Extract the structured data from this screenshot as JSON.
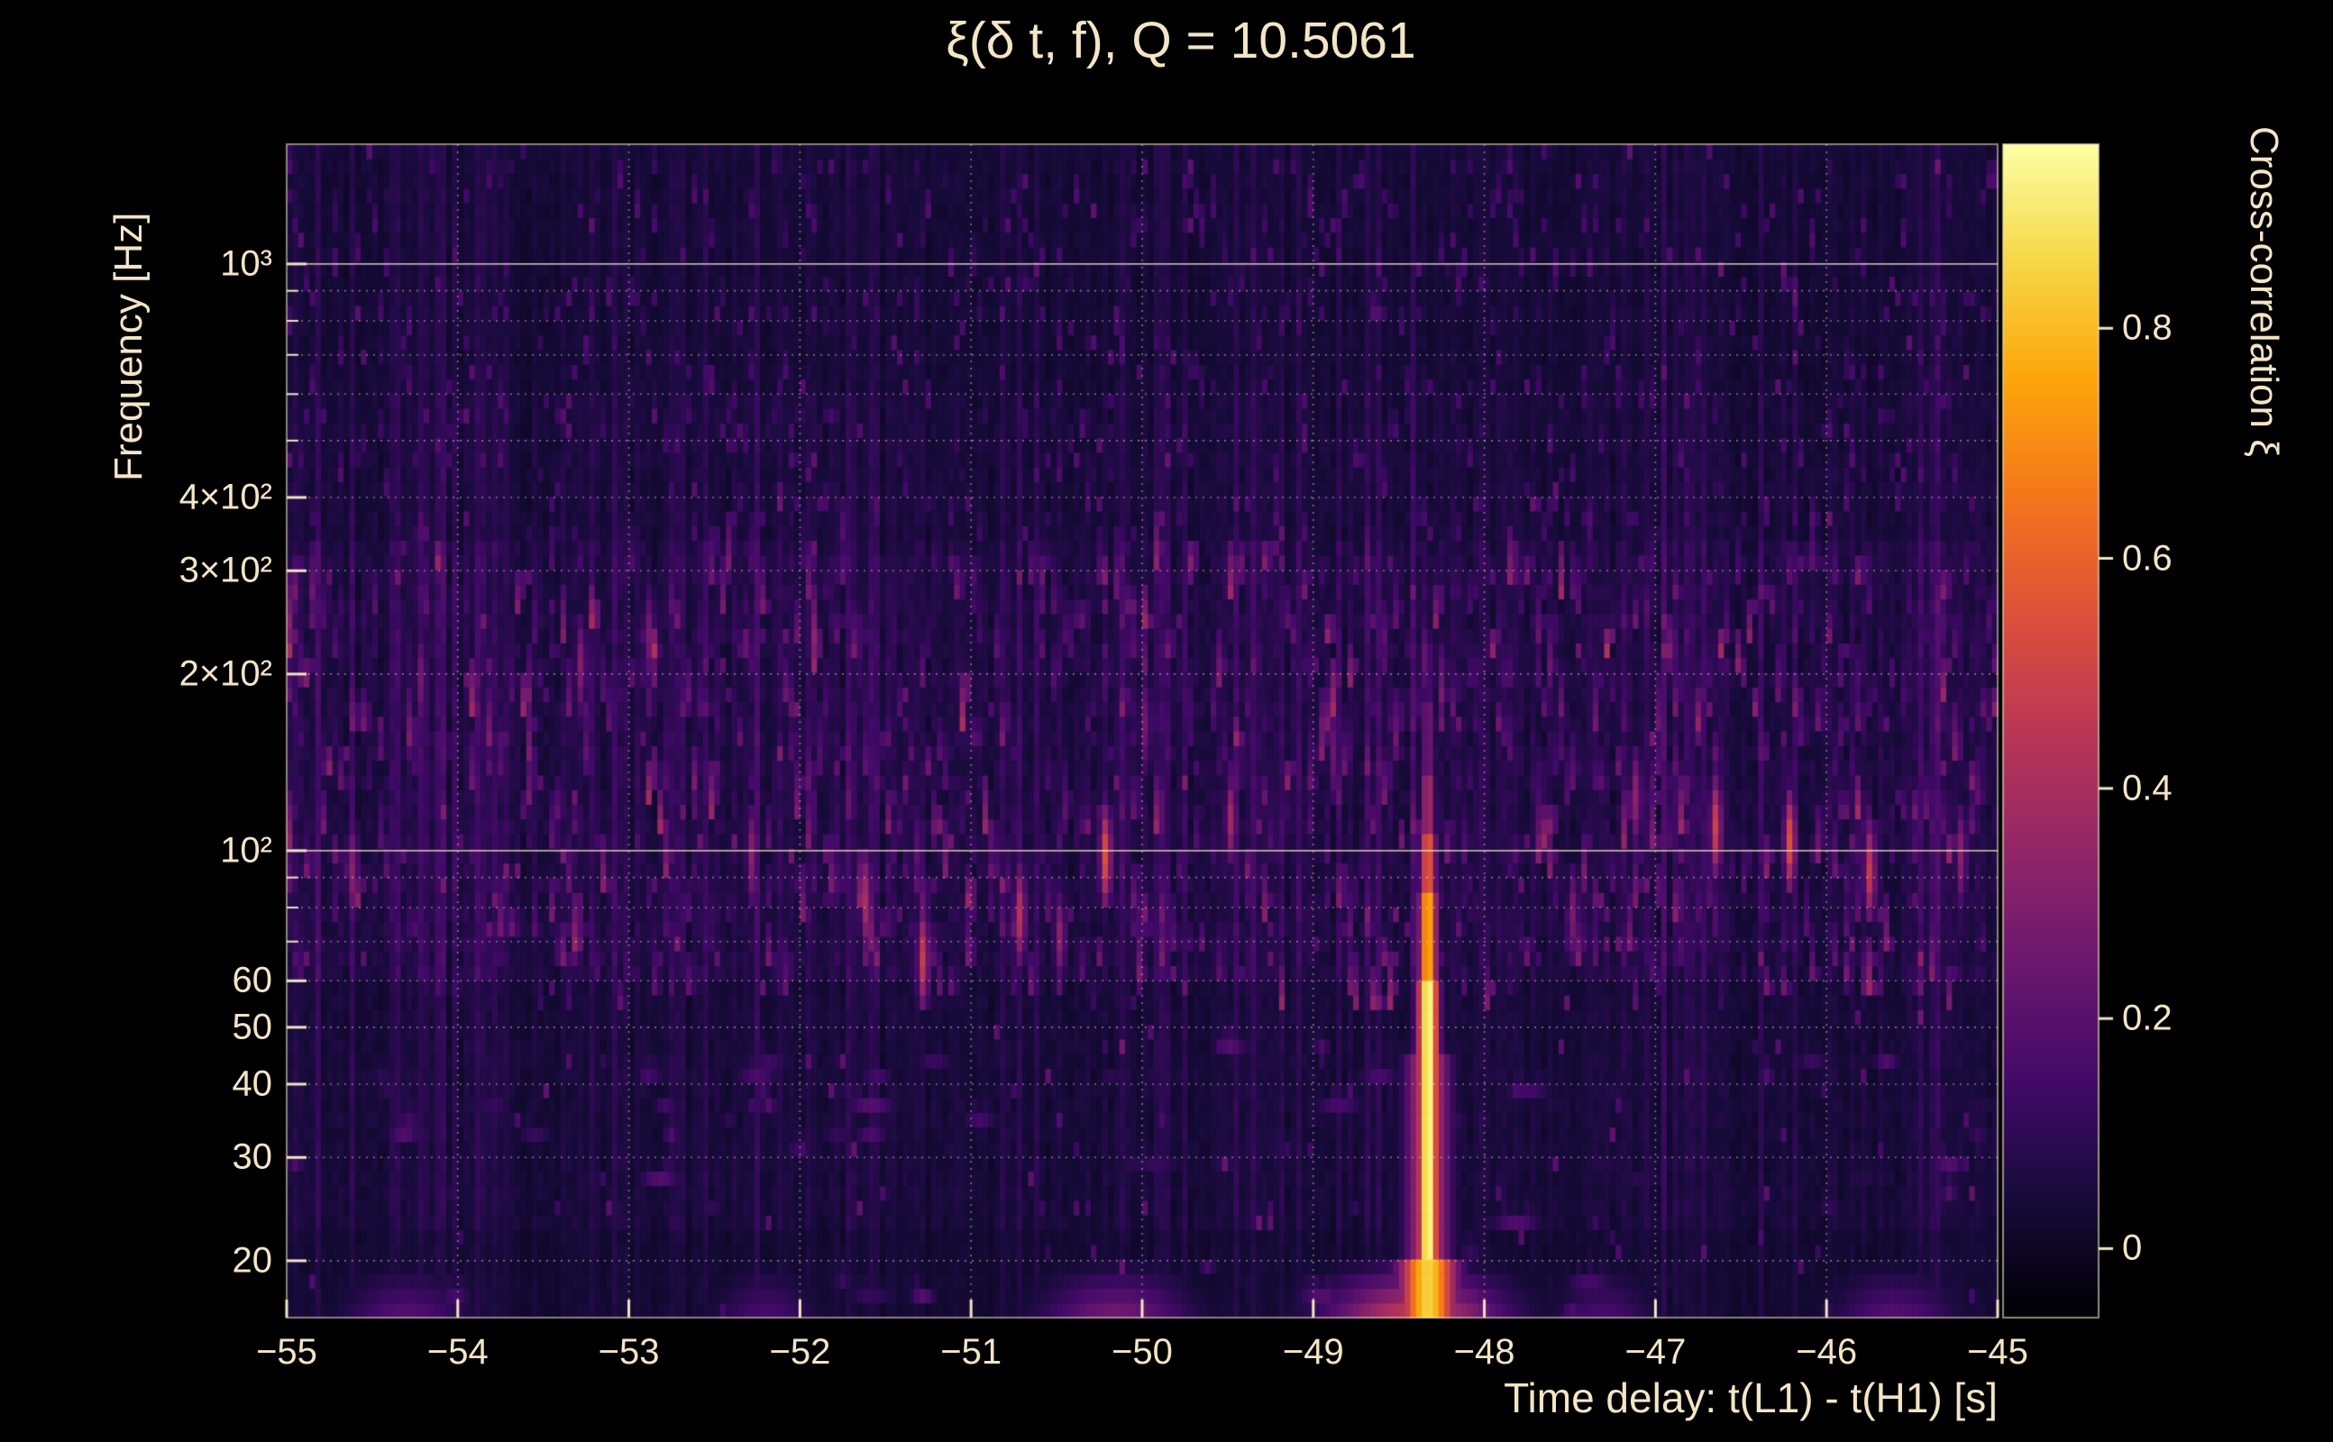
{
  "figure": {
    "background": "#000000",
    "foreground": "#f3e5c6"
  },
  "chart_data": {
    "type": "heatmap",
    "title": "ξ(δ t, f), Q = 10.5061",
    "xlabel": "Time delay: t(L1) - t(H1) [s]",
    "ylabel": "Frequency [Hz]",
    "x_range": [
      -55,
      -45
    ],
    "x_ticks": [
      -55,
      -54,
      -53,
      -52,
      -51,
      -50,
      -49,
      -48,
      -47,
      -46,
      -45
    ],
    "x_tick_labels": [
      "−55",
      "−54",
      "−53",
      "−52",
      "−51",
      "−50",
      "−49",
      "−48",
      "−47",
      "−46",
      "−45"
    ],
    "y_scale": "log",
    "y_range": [
      16,
      1600
    ],
    "y_ticks": [
      20,
      30,
      40,
      50,
      60,
      100,
      200,
      300,
      400,
      1000
    ],
    "y_tick_labels": [
      "20",
      "30",
      "40",
      "50",
      "60",
      "10²",
      "2×10²",
      "3×10²",
      "4×10²",
      "10³"
    ],
    "y_minor_ticks": [
      70,
      80,
      90,
      500,
      600,
      700,
      800,
      900
    ],
    "grid": {
      "style": "dotted",
      "color": "#f3e5c6"
    },
    "colormap": "inferno",
    "colorbar": {
      "label": "Cross-correlation ξ",
      "ticks": [
        0,
        0.2,
        0.4,
        0.6,
        0.8
      ],
      "tick_labels": [
        "0",
        "0.2",
        "0.4",
        "0.6",
        "0.8"
      ],
      "vmin": -0.06,
      "vmax": 0.96
    },
    "main_feature": {
      "description": "strong vertical cross-correlation streak",
      "x": -48.33,
      "segments": [
        {
          "f_lo": 16,
          "f_hi": 20,
          "value": 0.85,
          "halfwidth_s": 0.16
        },
        {
          "f_lo": 20,
          "f_hi": 45,
          "value": 0.5,
          "halfwidth_s": 0.12
        },
        {
          "f_lo": 20,
          "f_hi": 60,
          "value": 0.97,
          "halfwidth_s": 0.06
        },
        {
          "f_lo": 60,
          "f_hi": 85,
          "value": 0.8,
          "halfwidth_s": 0.05
        },
        {
          "f_lo": 85,
          "f_hi": 110,
          "value": 0.6,
          "halfwidth_s": 0.045
        },
        {
          "f_lo": 110,
          "f_hi": 135,
          "value": 0.4,
          "halfwidth_s": 0.04
        },
        {
          "f_lo": 135,
          "f_hi": 175,
          "value": 0.26,
          "halfwidth_s": 0.04
        },
        {
          "f_lo": 175,
          "f_hi": 230,
          "value": 0.16,
          "halfwidth_s": 0.04
        }
      ]
    },
    "hotspots": [
      {
        "x": -54.6,
        "f": 90,
        "value": 0.32
      },
      {
        "x": -54.2,
        "f": 190,
        "value": 0.26
      },
      {
        "x": -53.3,
        "f": 205,
        "value": 0.3
      },
      {
        "x": -52.9,
        "f": 230,
        "value": 0.27
      },
      {
        "x": -52.3,
        "f": 96,
        "value": 0.32
      },
      {
        "x": -51.6,
        "f": 81,
        "value": 0.4
      },
      {
        "x": -51.3,
        "f": 64,
        "value": 0.48
      },
      {
        "x": -50.7,
        "f": 77,
        "value": 0.44
      },
      {
        "x": -50.5,
        "f": 70,
        "value": 0.33
      },
      {
        "x": -50.2,
        "f": 95,
        "value": 0.55
      },
      {
        "x": -50.0,
        "f": 160,
        "value": 0.26
      },
      {
        "x": -49.5,
        "f": 112,
        "value": 0.38
      },
      {
        "x": -48.9,
        "f": 145,
        "value": 0.24
      },
      {
        "x": -48.35,
        "f": 210,
        "value": 0.22
      },
      {
        "x": -47.5,
        "f": 78,
        "value": 0.28
      },
      {
        "x": -47.1,
        "f": 120,
        "value": 0.33
      },
      {
        "x": -46.65,
        "f": 108,
        "value": 0.5
      },
      {
        "x": -46.2,
        "f": 100,
        "value": 0.55
      },
      {
        "x": -45.75,
        "f": 93,
        "value": 0.48
      },
      {
        "x": -45.2,
        "f": 95,
        "value": 0.32
      }
    ],
    "floor_blobs": [
      {
        "x": -54.3,
        "value": 0.18,
        "halfwidth_s": 0.25
      },
      {
        "x": -52.2,
        "value": 0.15,
        "halfwidth_s": 0.2
      },
      {
        "x": -50.15,
        "value": 0.25,
        "halfwidth_s": 0.3
      },
      {
        "x": -48.4,
        "value": 0.45,
        "halfwidth_s": 0.35
      },
      {
        "x": -47.3,
        "value": 0.15,
        "halfwidth_s": 0.2
      },
      {
        "x": -45.6,
        "value": 0.18,
        "halfwidth_s": 0.25
      }
    ],
    "noise": {
      "seed": 42,
      "background_value_range": [
        0.0,
        0.12
      ],
      "speckle_band_hz": [
        55,
        320
      ],
      "speckle_max_value": 0.45
    }
  }
}
